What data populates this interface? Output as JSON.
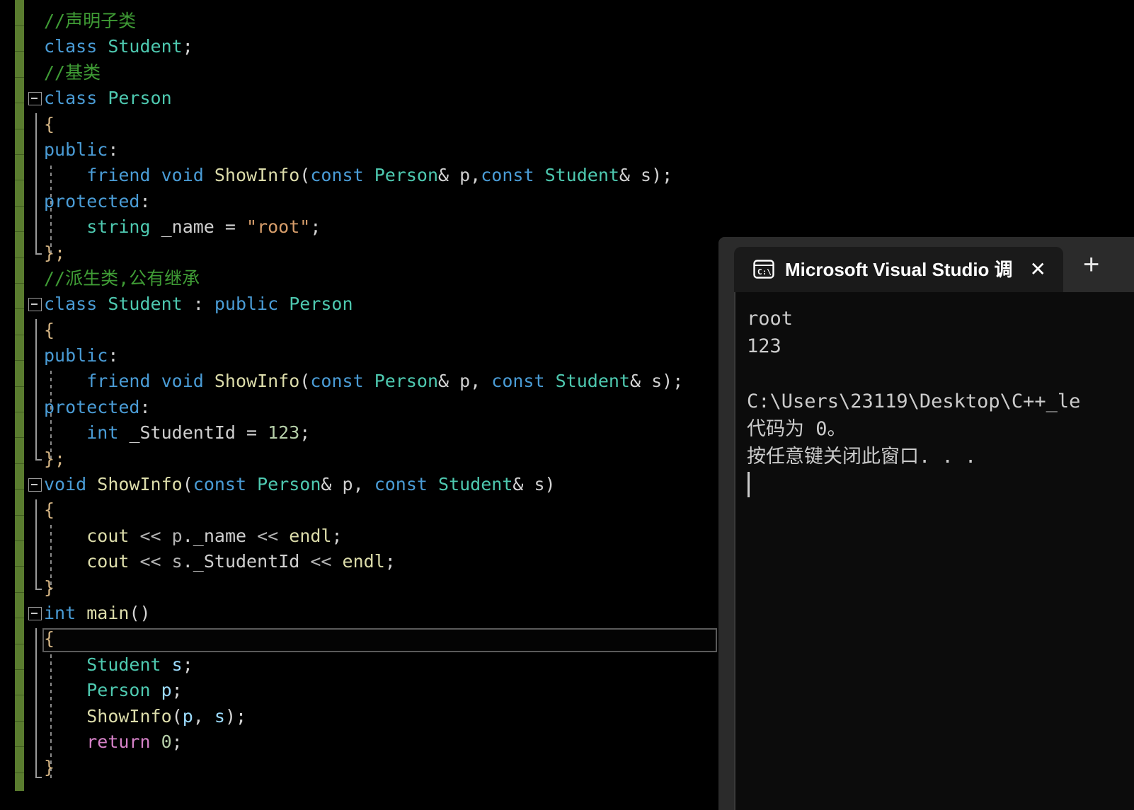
{
  "editor": {
    "name": "code-editor",
    "background": "#000000",
    "change_bar_color": "#5a7c2f",
    "lines": [
      {
        "indent": 0,
        "tokens": [
          {
            "t": "//声明子类",
            "c": "cmt"
          }
        ]
      },
      {
        "indent": 0,
        "tokens": [
          {
            "t": "class",
            "c": "kw"
          },
          {
            "t": " ",
            "c": "plain"
          },
          {
            "t": "Student",
            "c": "type"
          },
          {
            "t": ";",
            "c": "plain"
          }
        ]
      },
      {
        "indent": 0,
        "tokens": [
          {
            "t": "//基类",
            "c": "cmt"
          }
        ]
      },
      {
        "indent": 0,
        "tokens": [
          {
            "t": "class",
            "c": "kw"
          },
          {
            "t": " ",
            "c": "plain"
          },
          {
            "t": "Person",
            "c": "type"
          }
        ]
      },
      {
        "indent": 0,
        "tokens": [
          {
            "t": "{",
            "c": "brace"
          }
        ]
      },
      {
        "indent": 0,
        "tokens": [
          {
            "t": "public",
            "c": "kw"
          },
          {
            "t": ":",
            "c": "plain"
          }
        ]
      },
      {
        "indent": 0,
        "tokens": [
          {
            "t": "    ",
            "c": "plain"
          },
          {
            "t": "friend",
            "c": "kw"
          },
          {
            "t": " ",
            "c": "plain"
          },
          {
            "t": "void",
            "c": "kw"
          },
          {
            "t": " ",
            "c": "plain"
          },
          {
            "t": "ShowInfo",
            "c": "fn"
          },
          {
            "t": "(",
            "c": "plain"
          },
          {
            "t": "const",
            "c": "kw"
          },
          {
            "t": " ",
            "c": "plain"
          },
          {
            "t": "Person",
            "c": "type"
          },
          {
            "t": "& ",
            "c": "plain"
          },
          {
            "t": "p",
            "c": "mem"
          },
          {
            "t": ",",
            "c": "plain"
          },
          {
            "t": "const",
            "c": "kw"
          },
          {
            "t": " ",
            "c": "plain"
          },
          {
            "t": "Student",
            "c": "type"
          },
          {
            "t": "& ",
            "c": "plain"
          },
          {
            "t": "s",
            "c": "mem"
          },
          {
            "t": ");",
            "c": "plain"
          }
        ]
      },
      {
        "indent": 0,
        "tokens": [
          {
            "t": "protected",
            "c": "kw"
          },
          {
            "t": ":",
            "c": "plain"
          }
        ]
      },
      {
        "indent": 0,
        "tokens": [
          {
            "t": "    ",
            "c": "plain"
          },
          {
            "t": "string",
            "c": "type"
          },
          {
            "t": " ",
            "c": "plain"
          },
          {
            "t": "_name",
            "c": "mem"
          },
          {
            "t": " = ",
            "c": "plain"
          },
          {
            "t": "\"root\"",
            "c": "str"
          },
          {
            "t": ";",
            "c": "plain"
          }
        ]
      },
      {
        "indent": 0,
        "tokens": [
          {
            "t": "};",
            "c": "brace"
          }
        ]
      },
      {
        "indent": 0,
        "tokens": [
          {
            "t": "//派生类,公有继承",
            "c": "cmt"
          }
        ]
      },
      {
        "indent": 0,
        "tokens": [
          {
            "t": "class",
            "c": "kw"
          },
          {
            "t": " ",
            "c": "plain"
          },
          {
            "t": "Student",
            "c": "type"
          },
          {
            "t": " : ",
            "c": "plain"
          },
          {
            "t": "public",
            "c": "kw"
          },
          {
            "t": " ",
            "c": "plain"
          },
          {
            "t": "Person",
            "c": "type"
          }
        ]
      },
      {
        "indent": 0,
        "tokens": [
          {
            "t": "{",
            "c": "brace"
          }
        ]
      },
      {
        "indent": 0,
        "tokens": [
          {
            "t": "public",
            "c": "kw"
          },
          {
            "t": ":",
            "c": "plain"
          }
        ]
      },
      {
        "indent": 0,
        "tokens": [
          {
            "t": "    ",
            "c": "plain"
          },
          {
            "t": "friend",
            "c": "kw"
          },
          {
            "t": " ",
            "c": "plain"
          },
          {
            "t": "void",
            "c": "kw"
          },
          {
            "t": " ",
            "c": "plain"
          },
          {
            "t": "ShowInfo",
            "c": "fn"
          },
          {
            "t": "(",
            "c": "plain"
          },
          {
            "t": "const",
            "c": "kw"
          },
          {
            "t": " ",
            "c": "plain"
          },
          {
            "t": "Person",
            "c": "type"
          },
          {
            "t": "& ",
            "c": "plain"
          },
          {
            "t": "p",
            "c": "mem"
          },
          {
            "t": ", ",
            "c": "plain"
          },
          {
            "t": "const",
            "c": "kw"
          },
          {
            "t": " ",
            "c": "plain"
          },
          {
            "t": "Student",
            "c": "type"
          },
          {
            "t": "& ",
            "c": "plain"
          },
          {
            "t": "s",
            "c": "mem"
          },
          {
            "t": ");",
            "c": "plain"
          }
        ]
      },
      {
        "indent": 0,
        "tokens": [
          {
            "t": "protected",
            "c": "kw"
          },
          {
            "t": ":",
            "c": "plain"
          }
        ]
      },
      {
        "indent": 0,
        "tokens": [
          {
            "t": "    ",
            "c": "plain"
          },
          {
            "t": "int",
            "c": "kw"
          },
          {
            "t": " ",
            "c": "plain"
          },
          {
            "t": "_StudentId",
            "c": "mem"
          },
          {
            "t": " = ",
            "c": "plain"
          },
          {
            "t": "123",
            "c": "num"
          },
          {
            "t": ";",
            "c": "plain"
          }
        ]
      },
      {
        "indent": 0,
        "tokens": [
          {
            "t": "};",
            "c": "brace"
          }
        ]
      },
      {
        "indent": 0,
        "tokens": [
          {
            "t": "void",
            "c": "kw"
          },
          {
            "t": " ",
            "c": "plain"
          },
          {
            "t": "ShowInfo",
            "c": "fn"
          },
          {
            "t": "(",
            "c": "plain"
          },
          {
            "t": "const",
            "c": "kw"
          },
          {
            "t": " ",
            "c": "plain"
          },
          {
            "t": "Person",
            "c": "type"
          },
          {
            "t": "& ",
            "c": "plain"
          },
          {
            "t": "p",
            "c": "mem"
          },
          {
            "t": ", ",
            "c": "plain"
          },
          {
            "t": "const",
            "c": "kw"
          },
          {
            "t": " ",
            "c": "plain"
          },
          {
            "t": "Student",
            "c": "type"
          },
          {
            "t": "& ",
            "c": "plain"
          },
          {
            "t": "s",
            "c": "mem"
          },
          {
            "t": ")",
            "c": "plain"
          }
        ]
      },
      {
        "indent": 0,
        "tokens": [
          {
            "t": "{",
            "c": "brace"
          }
        ]
      },
      {
        "indent": 0,
        "tokens": [
          {
            "t": "    ",
            "c": "plain"
          },
          {
            "t": "cout",
            "c": "fn"
          },
          {
            "t": " ",
            "c": "plain"
          },
          {
            "t": "<<",
            "c": "op"
          },
          {
            "t": " ",
            "c": "plain"
          },
          {
            "t": "p",
            "c": "op"
          },
          {
            "t": ".",
            "c": "plain"
          },
          {
            "t": "_name",
            "c": "mem"
          },
          {
            "t": " ",
            "c": "plain"
          },
          {
            "t": "<<",
            "c": "op"
          },
          {
            "t": " ",
            "c": "plain"
          },
          {
            "t": "endl",
            "c": "fn"
          },
          {
            "t": ";",
            "c": "plain"
          }
        ]
      },
      {
        "indent": 0,
        "tokens": [
          {
            "t": "    ",
            "c": "plain"
          },
          {
            "t": "cout",
            "c": "fn"
          },
          {
            "t": " ",
            "c": "plain"
          },
          {
            "t": "<<",
            "c": "op"
          },
          {
            "t": " ",
            "c": "plain"
          },
          {
            "t": "s",
            "c": "op"
          },
          {
            "t": ".",
            "c": "plain"
          },
          {
            "t": "_StudentId",
            "c": "mem"
          },
          {
            "t": " ",
            "c": "plain"
          },
          {
            "t": "<<",
            "c": "op"
          },
          {
            "t": " ",
            "c": "plain"
          },
          {
            "t": "endl",
            "c": "fn"
          },
          {
            "t": ";",
            "c": "plain"
          }
        ]
      },
      {
        "indent": 0,
        "tokens": [
          {
            "t": "}",
            "c": "brace"
          }
        ]
      },
      {
        "indent": 0,
        "tokens": [
          {
            "t": "int",
            "c": "kw"
          },
          {
            "t": " ",
            "c": "plain"
          },
          {
            "t": "main",
            "c": "fn"
          },
          {
            "t": "()",
            "c": "plain"
          }
        ]
      },
      {
        "indent": 0,
        "tokens": [
          {
            "t": "{",
            "c": "brace"
          }
        ]
      },
      {
        "indent": 0,
        "tokens": [
          {
            "t": "    ",
            "c": "plain"
          },
          {
            "t": "Student",
            "c": "type"
          },
          {
            "t": " ",
            "c": "plain"
          },
          {
            "t": "s",
            "c": "var"
          },
          {
            "t": ";",
            "c": "plain"
          }
        ]
      },
      {
        "indent": 0,
        "tokens": [
          {
            "t": "    ",
            "c": "plain"
          },
          {
            "t": "Person",
            "c": "type"
          },
          {
            "t": " ",
            "c": "plain"
          },
          {
            "t": "p",
            "c": "var"
          },
          {
            "t": ";",
            "c": "plain"
          }
        ]
      },
      {
        "indent": 0,
        "tokens": [
          {
            "t": "    ",
            "c": "plain"
          },
          {
            "t": "ShowInfo",
            "c": "fn"
          },
          {
            "t": "(",
            "c": "plain"
          },
          {
            "t": "p",
            "c": "var"
          },
          {
            "t": ", ",
            "c": "plain"
          },
          {
            "t": "s",
            "c": "var"
          },
          {
            "t": ");",
            "c": "plain"
          }
        ]
      },
      {
        "indent": 0,
        "tokens": [
          {
            "t": "    ",
            "c": "plain"
          },
          {
            "t": "return",
            "c": "ctl"
          },
          {
            "t": " ",
            "c": "plain"
          },
          {
            "t": "0",
            "c": "num"
          },
          {
            "t": ";",
            "c": "plain"
          }
        ]
      },
      {
        "indent": 0,
        "tokens": [
          {
            "t": "}",
            "c": "brace"
          }
        ]
      }
    ],
    "fold_lines": [
      3,
      11,
      18,
      23
    ],
    "selected_line": 24
  },
  "console": {
    "name": "visual-studio-debug-console",
    "tab_title": "Microsoft Visual Studio 调试控",
    "tab_icon": "console-cmd-icon",
    "close_label": "✕",
    "new_tab_label": "+",
    "background": "#0c0c0c",
    "titlebar_background": "#2b2b2b",
    "output_lines": [
      "root",
      "123",
      "",
      "C:\\Users\\23119\\Desktop\\C++_le",
      "代码为 0。",
      "按任意键关闭此窗口. . ."
    ]
  }
}
